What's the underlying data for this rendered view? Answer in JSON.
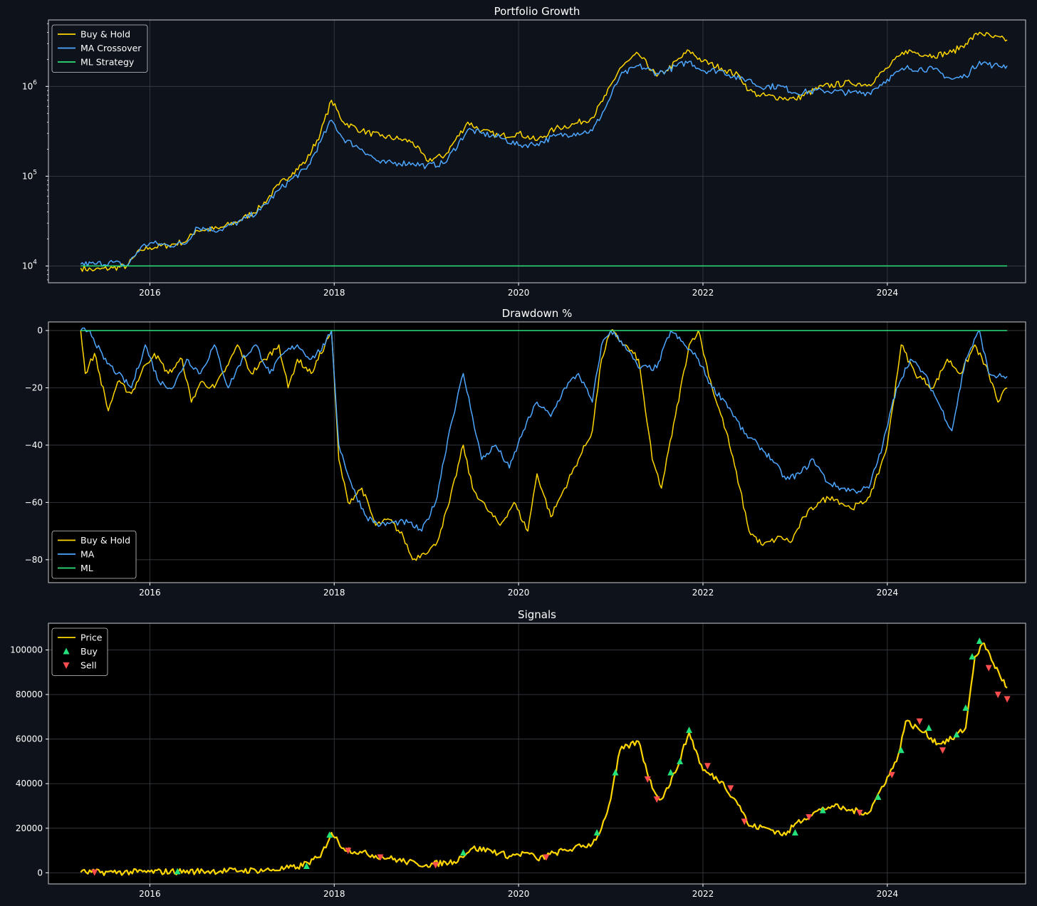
{
  "colors": {
    "figure_bg": "#0e121a",
    "axes_bg_top": "#0e121a",
    "axes_bg_other": "#000000",
    "buy_hold": "#ffd700",
    "ma": "#4da6ff",
    "ml": "#2ee07a",
    "buy_marker": "#22e07a",
    "sell_marker": "#ff4d4d",
    "grid": "#3a3f47",
    "text": "#ffffff"
  },
  "chart_data": [
    {
      "type": "line",
      "title": "Portfolio Growth",
      "yscale": "log",
      "xlim": [
        2014.9,
        2025.5
      ],
      "ylim": [
        6500,
        5500000
      ],
      "x_ticks": [
        2016,
        2018,
        2020,
        2022,
        2024
      ],
      "x_tick_labels": [
        "2016",
        "2018",
        "2020",
        "2022",
        "2024"
      ],
      "y_ticks": [
        10000,
        100000,
        1000000
      ],
      "y_tick_labels": [
        {
          "base": "10",
          "exp": "4"
        },
        {
          "base": "10",
          "exp": "5"
        },
        {
          "base": "10",
          "exp": "6"
        }
      ],
      "legend": {
        "position": "top-left",
        "entries": [
          "Buy & Hold",
          "MA Crossover",
          "ML Strategy"
        ]
      },
      "grid": true,
      "series": [
        {
          "name": "Buy & Hold",
          "color_key": "buy_hold",
          "x": [
            2015.25,
            2015.4,
            2015.6,
            2015.75,
            2015.9,
            2016.0,
            2016.2,
            2016.4,
            2016.5,
            2016.75,
            2017.0,
            2017.2,
            2017.4,
            2017.55,
            2017.7,
            2017.85,
            2017.97,
            2018.1,
            2018.3,
            2018.5,
            2018.7,
            2018.85,
            2019.0,
            2019.2,
            2019.45,
            2019.6,
            2019.8,
            2020.0,
            2020.2,
            2020.4,
            2020.6,
            2020.8,
            2020.95,
            2021.1,
            2021.3,
            2021.5,
            2021.6,
            2021.85,
            2022.0,
            2022.2,
            2022.4,
            2022.5,
            2022.6,
            2022.85,
            2023.0,
            2023.3,
            2023.6,
            2023.8,
            2024.0,
            2024.2,
            2024.5,
            2024.7,
            2024.85,
            2025.0,
            2025.15,
            2025.3
          ],
          "y": [
            9500,
            9000,
            9500,
            10000,
            15000,
            16000,
            17000,
            19000,
            25000,
            26000,
            33000,
            45000,
            80000,
            110000,
            150000,
            300000,
            700000,
            400000,
            320000,
            280000,
            260000,
            240000,
            150000,
            170000,
            400000,
            320000,
            280000,
            300000,
            250000,
            340000,
            380000,
            450000,
            800000,
            1600000,
            2300000,
            1300000,
            1500000,
            2500000,
            1900000,
            1600000,
            1300000,
            900000,
            800000,
            750000,
            720000,
            1000000,
            1100000,
            1050000,
            1600000,
            2500000,
            2200000,
            2400000,
            3000000,
            4000000,
            3500000,
            3300000
          ]
        },
        {
          "name": "MA Crossover",
          "color_key": "ma",
          "x": [
            2015.25,
            2015.4,
            2015.6,
            2015.75,
            2015.9,
            2016.0,
            2016.2,
            2016.4,
            2016.5,
            2016.75,
            2017.0,
            2017.2,
            2017.4,
            2017.55,
            2017.7,
            2017.85,
            2017.97,
            2018.1,
            2018.3,
            2018.5,
            2018.7,
            2018.85,
            2019.0,
            2019.2,
            2019.45,
            2019.6,
            2019.8,
            2020.0,
            2020.2,
            2020.4,
            2020.6,
            2020.8,
            2020.95,
            2021.1,
            2021.3,
            2021.5,
            2021.6,
            2021.85,
            2022.0,
            2022.2,
            2022.4,
            2022.5,
            2022.6,
            2022.85,
            2023.0,
            2023.3,
            2023.6,
            2023.8,
            2024.0,
            2024.2,
            2024.5,
            2024.7,
            2024.85,
            2025.0,
            2025.15,
            2025.3
          ],
          "y": [
            10500,
            10500,
            11000,
            10000,
            16000,
            18000,
            17000,
            18000,
            27000,
            25000,
            32000,
            42000,
            70000,
            95000,
            120000,
            240000,
            420000,
            260000,
            200000,
            140000,
            140000,
            140000,
            130000,
            140000,
            330000,
            300000,
            270000,
            220000,
            230000,
            280000,
            300000,
            320000,
            600000,
            1300000,
            1700000,
            1400000,
            1500000,
            1900000,
            1500000,
            1500000,
            1200000,
            1200000,
            1000000,
            1000000,
            850000,
            900000,
            850000,
            850000,
            1200000,
            1600000,
            1550000,
            1200000,
            1300000,
            1900000,
            1700000,
            1700000
          ]
        },
        {
          "name": "ML Strategy",
          "color_key": "ml",
          "x": [
            2015.25,
            2025.3
          ],
          "y": [
            10000,
            10000
          ]
        }
      ]
    },
    {
      "type": "line",
      "title": "Drawdown %",
      "xlim": [
        2014.9,
        2025.5
      ],
      "ylim": [
        -88,
        3
      ],
      "x_ticks": [
        2016,
        2018,
        2020,
        2022,
        2024
      ],
      "x_tick_labels": [
        "2016",
        "2018",
        "2020",
        "2022",
        "2024"
      ],
      "y_ticks": [
        0,
        -20,
        -40,
        -60,
        -80
      ],
      "y_tick_labels": [
        "0",
        "−20",
        "−40",
        "−60",
        "−80"
      ],
      "legend": {
        "position": "bottom-left",
        "entries": [
          "Buy & Hold",
          "MA",
          "ML"
        ]
      },
      "grid": true,
      "series": [
        {
          "name": "Buy & Hold",
          "color_key": "buy_hold",
          "x": [
            2015.25,
            2015.3,
            2015.4,
            2015.55,
            2015.65,
            2015.8,
            2015.95,
            2016.05,
            2016.2,
            2016.35,
            2016.45,
            2016.55,
            2016.7,
            2016.85,
            2016.95,
            2017.1,
            2017.25,
            2017.4,
            2017.5,
            2017.6,
            2017.75,
            2017.9,
            2017.97,
            2018.05,
            2018.15,
            2018.3,
            2018.45,
            2018.6,
            2018.75,
            2018.85,
            2018.95,
            2019.1,
            2019.25,
            2019.4,
            2019.5,
            2019.65,
            2019.8,
            2019.95,
            2020.1,
            2020.2,
            2020.35,
            2020.5,
            2020.65,
            2020.8,
            2020.9,
            2021.0,
            2021.15,
            2021.3,
            2021.45,
            2021.55,
            2021.7,
            2021.85,
            2021.95,
            2022.1,
            2022.25,
            2022.4,
            2022.5,
            2022.65,
            2022.85,
            2022.95,
            2023.1,
            2023.25,
            2023.4,
            2023.6,
            2023.75,
            2023.85,
            2024.0,
            2024.15,
            2024.3,
            2024.5,
            2024.65,
            2024.8,
            2024.95,
            2025.1,
            2025.2,
            2025.3
          ],
          "y": [
            0,
            -15,
            -8,
            -28,
            -18,
            -22,
            -12,
            -8,
            -15,
            -10,
            -25,
            -18,
            -20,
            -12,
            -5,
            -15,
            -10,
            -5,
            -20,
            -10,
            -15,
            -5,
            0,
            -45,
            -60,
            -55,
            -68,
            -66,
            -72,
            -80,
            -78,
            -75,
            -60,
            -40,
            -55,
            -62,
            -68,
            -60,
            -70,
            -50,
            -65,
            -55,
            -45,
            -35,
            -10,
            0,
            -5,
            -10,
            -45,
            -55,
            -30,
            -5,
            0,
            -20,
            -35,
            -55,
            -70,
            -75,
            -72,
            -74,
            -65,
            -60,
            -58,
            -62,
            -60,
            -55,
            -40,
            -5,
            -15,
            -20,
            -10,
            -15,
            -5,
            -15,
            -25,
            -20
          ]
        },
        {
          "name": "MA",
          "color_key": "ma",
          "x": [
            2015.25,
            2015.35,
            2015.5,
            2015.65,
            2015.8,
            2015.95,
            2016.1,
            2016.25,
            2016.4,
            2016.55,
            2016.7,
            2016.85,
            2017.0,
            2017.15,
            2017.3,
            2017.45,
            2017.6,
            2017.75,
            2017.9,
            2017.97,
            2018.05,
            2018.2,
            2018.35,
            2018.5,
            2018.65,
            2018.8,
            2018.95,
            2019.1,
            2019.25,
            2019.4,
            2019.5,
            2019.6,
            2019.75,
            2019.9,
            2020.05,
            2020.2,
            2020.35,
            2020.5,
            2020.65,
            2020.8,
            2020.9,
            2021.0,
            2021.15,
            2021.3,
            2021.5,
            2021.65,
            2021.8,
            2021.95,
            2022.1,
            2022.25,
            2022.45,
            2022.6,
            2022.75,
            2022.9,
            2023.05,
            2023.2,
            2023.35,
            2023.5,
            2023.65,
            2023.8,
            2023.95,
            2024.1,
            2024.25,
            2024.4,
            2024.55,
            2024.7,
            2024.85,
            2025.0,
            2025.1,
            2025.2,
            2025.3
          ],
          "y": [
            0,
            0,
            -10,
            -15,
            -20,
            -5,
            -18,
            -20,
            -10,
            -15,
            -5,
            -20,
            -10,
            -5,
            -15,
            -8,
            -5,
            -10,
            -5,
            0,
            -40,
            -55,
            -65,
            -68,
            -67,
            -67,
            -70,
            -60,
            -35,
            -15,
            -30,
            -45,
            -40,
            -48,
            -35,
            -25,
            -30,
            -20,
            -15,
            -25,
            -5,
            0,
            -5,
            -13,
            -13,
            0,
            -5,
            -10,
            -20,
            -25,
            -36,
            -40,
            -45,
            -52,
            -50,
            -45,
            -53,
            -55,
            -56,
            -55,
            -40,
            -20,
            -10,
            -15,
            -25,
            -35,
            -10,
            0,
            -15,
            -16,
            -16
          ]
        },
        {
          "name": "ML",
          "color_key": "ml",
          "x": [
            2015.25,
            2025.3
          ],
          "y": [
            0,
            0
          ]
        }
      ]
    },
    {
      "type": "line",
      "title": "Signals",
      "xlim": [
        2014.9,
        2025.5
      ],
      "ylim": [
        -5000,
        112000
      ],
      "x_ticks": [
        2016,
        2018,
        2020,
        2022,
        2024
      ],
      "x_tick_labels": [
        "2016",
        "2018",
        "2020",
        "2022",
        "2024"
      ],
      "y_ticks": [
        0,
        20000,
        40000,
        60000,
        80000,
        100000
      ],
      "y_tick_labels": [
        "0",
        "20000",
        "40000",
        "60000",
        "80000",
        "100000"
      ],
      "legend": {
        "position": "top-left",
        "entries": [
          "Price",
          "Buy",
          "Sell"
        ]
      },
      "grid": true,
      "series": [
        {
          "name": "Price",
          "color_key": "buy_hold",
          "x": [
            2015.25,
            2015.6,
            2016.0,
            2016.5,
            2017.0,
            2017.3,
            2017.6,
            2017.85,
            2017.97,
            2018.1,
            2018.3,
            2018.6,
            2018.9,
            2019.0,
            2019.3,
            2019.5,
            2019.7,
            2019.9,
            2020.1,
            2020.2,
            2020.4,
            2020.6,
            2020.8,
            2020.9,
            2021.0,
            2021.1,
            2021.3,
            2021.45,
            2021.55,
            2021.7,
            2021.85,
            2022.0,
            2022.2,
            2022.4,
            2022.5,
            2022.7,
            2022.9,
            2023.0,
            2023.2,
            2023.4,
            2023.6,
            2023.8,
            2024.0,
            2024.1,
            2024.2,
            2024.4,
            2024.55,
            2024.7,
            2024.85,
            2024.95,
            2025.05,
            2025.15,
            2025.3
          ],
          "y": [
            250,
            250,
            430,
            650,
            1000,
            1200,
            2500,
            7000,
            18000,
            11000,
            9000,
            6500,
            4000,
            3600,
            5000,
            11000,
            10000,
            7500,
            9000,
            6000,
            9000,
            11000,
            13000,
            20000,
            33000,
            55000,
            59000,
            38000,
            33000,
            45000,
            63000,
            46000,
            41000,
            30000,
            21000,
            20000,
            17000,
            22000,
            27000,
            30000,
            28000,
            27000,
            43000,
            50000,
            68000,
            63000,
            58000,
            60000,
            65000,
            97000,
            103000,
            94000,
            83000
          ]
        },
        {
          "name": "Buy",
          "marker": "triangle-up",
          "color_key": "buy_marker",
          "x": [
            2016.3,
            2017.7,
            2017.95,
            2019.4,
            2020.85,
            2021.05,
            2021.65,
            2021.75,
            2021.85,
            2023.0,
            2023.3,
            2023.9,
            2024.15,
            2024.45,
            2024.75,
            2024.85,
            2024.92,
            2025.0
          ],
          "y": [
            600,
            3000,
            17000,
            9000,
            18000,
            45000,
            45000,
            50000,
            64000,
            18000,
            28000,
            34000,
            55000,
            65000,
            62000,
            74000,
            97000,
            104000
          ]
        },
        {
          "name": "Sell",
          "marker": "triangle-down",
          "color_key": "sell_marker",
          "x": [
            2015.4,
            2018.15,
            2018.5,
            2019.1,
            2020.3,
            2021.4,
            2021.5,
            2022.05,
            2022.3,
            2022.45,
            2023.15,
            2023.7,
            2024.05,
            2024.35,
            2024.6,
            2025.1,
            2025.2,
            2025.3
          ],
          "y": [
            250,
            10000,
            7000,
            3500,
            7000,
            42000,
            33000,
            48000,
            38000,
            23000,
            25000,
            27000,
            44000,
            68000,
            55000,
            92000,
            80000,
            78000
          ]
        }
      ]
    }
  ]
}
